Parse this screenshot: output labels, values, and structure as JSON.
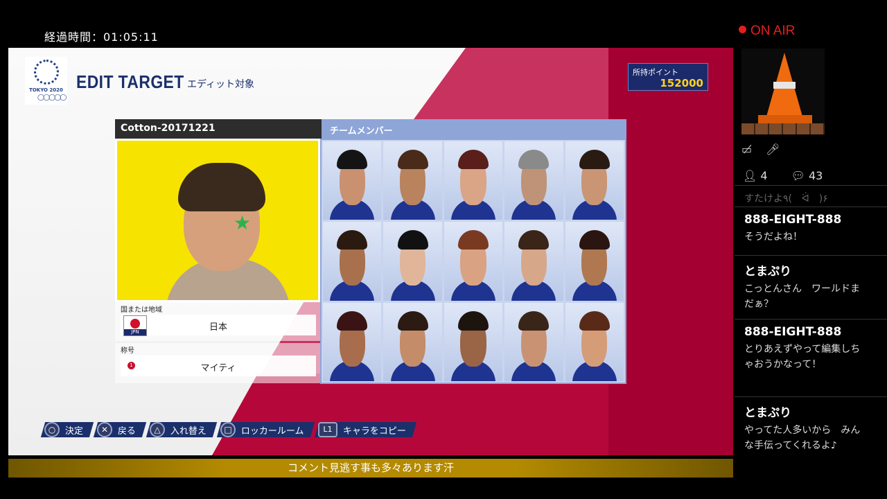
{
  "overlay": {
    "elapsed": "経過時間：01:05:11",
    "ticker": "コメント見逃す事も多々あります汗"
  },
  "game": {
    "logo_text": "TOKYO 2020",
    "logo_rings": "◯◯◯◯◯",
    "title_en": "EDIT TARGET",
    "title_jp": "エディット対象",
    "points_label": "所持ポイント",
    "points_value": "152000",
    "selected": {
      "name": "Cotton-20171221",
      "region_label": "国または地域",
      "region_value": "日本",
      "flag_code": "JPN",
      "title_label": "称号",
      "title_badge": "1",
      "title_value": "マイティ"
    },
    "team_header": "チームメンバー",
    "members": [
      {
        "skin": "#c99170",
        "hair": "#141414"
      },
      {
        "skin": "#b9835e",
        "hair": "#4a2a18"
      },
      {
        "skin": "#d9a586",
        "hair": "#5a1f1a"
      },
      {
        "skin": "#bf9378",
        "hair": "#8a8a8a"
      },
      {
        "skin": "#c99575",
        "hair": "#2a1b12"
      },
      {
        "skin": "#a8704d",
        "hair": "#2a1a10"
      },
      {
        "skin": "#e0b59a",
        "hair": "#111111"
      },
      {
        "skin": "#d9a283",
        "hair": "#7a3a22"
      },
      {
        "skin": "#d7a78a",
        "hair": "#3b2418"
      },
      {
        "skin": "#b07850",
        "hair": "#2a1510"
      },
      {
        "skin": "#a86d4c",
        "hair": "#3a1414"
      },
      {
        "skin": "#c48c68",
        "hair": "#2b1b12"
      },
      {
        "skin": "#9a6446",
        "hair": "#1e140e"
      },
      {
        "skin": "#c99272",
        "hair": "#3a2618"
      },
      {
        "skin": "#d59c78",
        "hair": "#5a2a18"
      }
    ],
    "prompts": [
      {
        "btn": "○",
        "label": "決定",
        "shape": "circle"
      },
      {
        "btn": "✕",
        "label": "戻る",
        "shape": "circle"
      },
      {
        "btn": "△",
        "label": "入れ替え",
        "shape": "circle"
      },
      {
        "btn": "□",
        "label": "ロッカールーム",
        "shape": "circle"
      },
      {
        "btn": "L1",
        "label": "キャラをコピー",
        "shape": "l1"
      }
    ]
  },
  "sidebar": {
    "onair": "ON AIR",
    "viewers": "4",
    "comments_count": "43",
    "partial_comment": "すたけよ۹(　ᐛ　)۶",
    "comments": [
      {
        "name": "888-EIGHT-888",
        "text": "そうだよね！"
      },
      {
        "name": "とまぷり",
        "text": "こっとんさん　ワールドまだぁ？"
      },
      {
        "name": "888-EIGHT-888",
        "text": "とりあえずやって編集しちゃおうかなって！"
      },
      {
        "name": "とまぷり",
        "text": "やってた人多いから　みんな手伝ってくれるよ♪"
      }
    ]
  }
}
